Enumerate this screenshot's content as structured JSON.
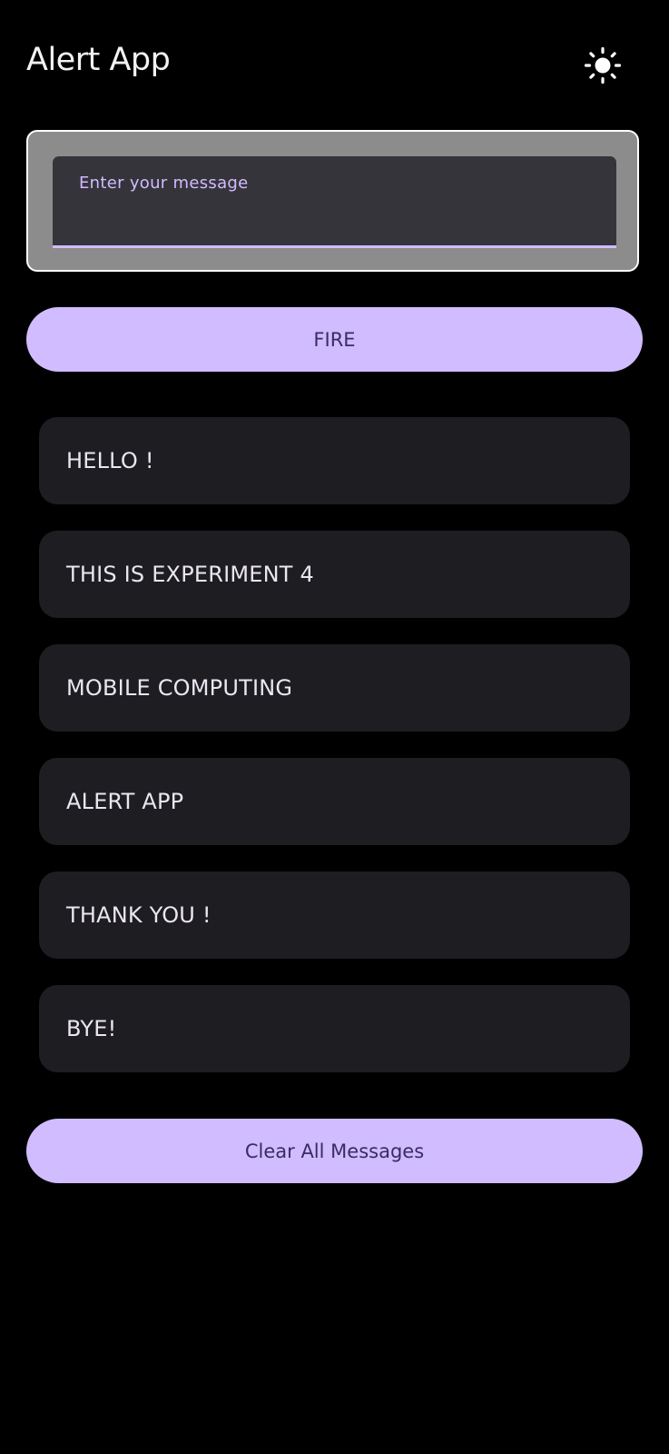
{
  "header": {
    "title": "Alert App",
    "theme_icon": "sun-icon"
  },
  "composer": {
    "placeholder": "Enter your message",
    "value": "",
    "fire_label": "FIRE"
  },
  "messages": [
    "HELLO !",
    "THIS IS EXPERIMENT 4",
    "MOBILE COMPUTING",
    "ALERT APP",
    "THANK YOU !",
    "BYE!"
  ],
  "footer": {
    "clear_label": "Clear All Messages"
  },
  "colors": {
    "background": "#000000",
    "accent": "#d0bcff",
    "accent_text": "#3a2b63",
    "card": "#1e1d22",
    "input_card": "#8c8c8c",
    "text_field": "#36343b"
  }
}
